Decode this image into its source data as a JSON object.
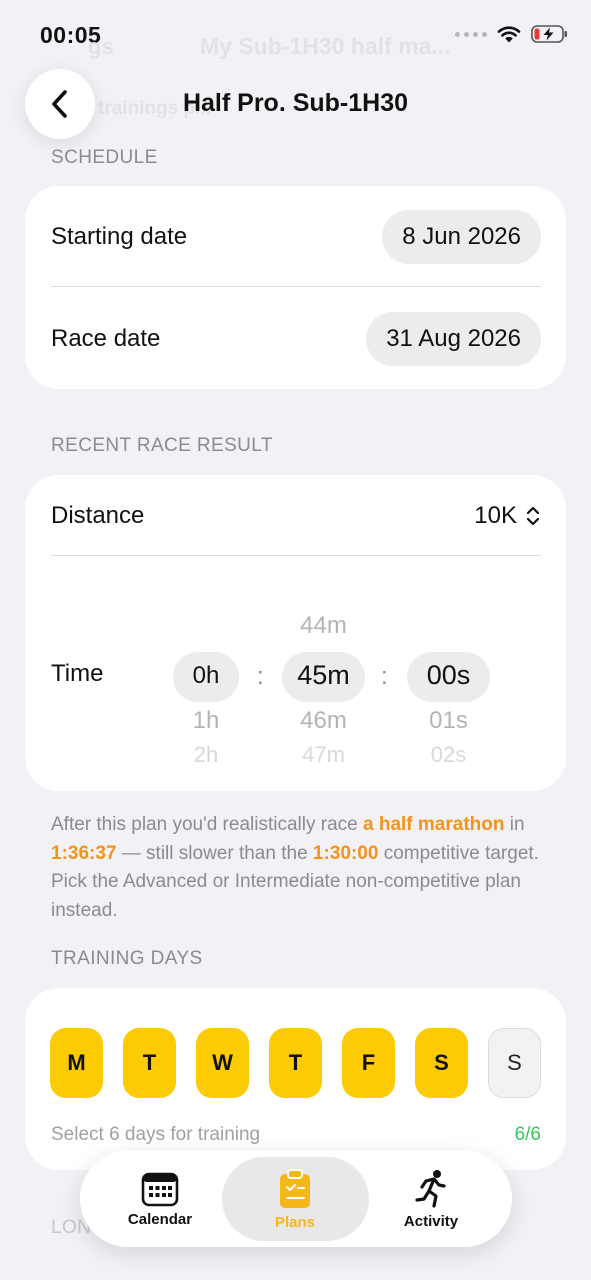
{
  "status": {
    "time": "00:05"
  },
  "header": {
    "title": "Half Pro. Sub-1H30",
    "back_label": "Back"
  },
  "background_ghost": {
    "left": "gs",
    "title": "My Sub-1H30 half ma...",
    "subtitle": "trainings p..."
  },
  "schedule": {
    "section_label": "SCHEDULE",
    "starting_date_label": "Starting date",
    "starting_date_value": "8 Jun 2026",
    "race_date_label": "Race date",
    "race_date_value": "31 Aug 2026"
  },
  "recent_race": {
    "section_label": "RECENT RACE RESULT",
    "distance_label": "Distance",
    "distance_value": "10K",
    "time_label": "Time",
    "hours": {
      "above": "",
      "selected": "0h",
      "below": "1h",
      "below2": "2h"
    },
    "minutes": {
      "above": "44m",
      "selected": "45m",
      "below": "46m",
      "below2": "47m"
    },
    "seconds": {
      "above": "",
      "selected": "00s",
      "below": "01s",
      "below2": "02s"
    },
    "separator": ":"
  },
  "note": {
    "part1": "After this plan you'd realistically race ",
    "hl1": "a half marathon",
    "part2": " in ",
    "hl2": "1:36:37",
    "part3": " — still slower than the ",
    "hl3": "1:30:00",
    "part4": " competitive target. Pick the Advanced or Intermediate non-competitive plan instead."
  },
  "training_days": {
    "section_label": "TRAINING DAYS",
    "days": [
      {
        "label": "M",
        "selected": true
      },
      {
        "label": "T",
        "selected": true
      },
      {
        "label": "W",
        "selected": true
      },
      {
        "label": "T",
        "selected": true
      },
      {
        "label": "F",
        "selected": true
      },
      {
        "label": "S",
        "selected": true
      },
      {
        "label": "S",
        "selected": false
      }
    ],
    "hint": "Select 6 days for training",
    "count": "6/6"
  },
  "next_section_partial": "LON",
  "tabbar": {
    "tabs": [
      {
        "label": "Calendar",
        "icon": "calendar-icon",
        "active": false
      },
      {
        "label": "Plans",
        "icon": "clipboard-icon",
        "active": true
      },
      {
        "label": "Activity",
        "icon": "runner-icon",
        "active": false
      }
    ]
  },
  "colors": {
    "accent_yellow": "#fccb03",
    "warning_orange": "#f3931a",
    "success_green": "#34c759",
    "background": "#f2f2f6"
  }
}
